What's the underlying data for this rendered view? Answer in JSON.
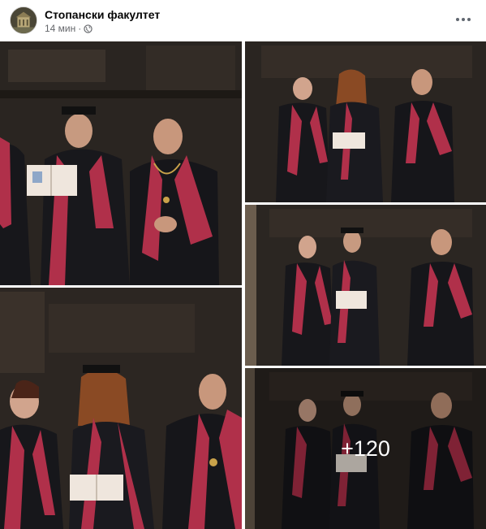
{
  "post": {
    "page_name": "Стопански факултет",
    "time": "14 мин",
    "separator": "·",
    "privacy_icon": "globe-icon",
    "more_icon": "more-options-icon"
  },
  "photos": {
    "more_count_label": "+120"
  },
  "colors": {
    "gown": "#1b1b1f",
    "stole": "#b0304a",
    "background": "#2c2622"
  }
}
